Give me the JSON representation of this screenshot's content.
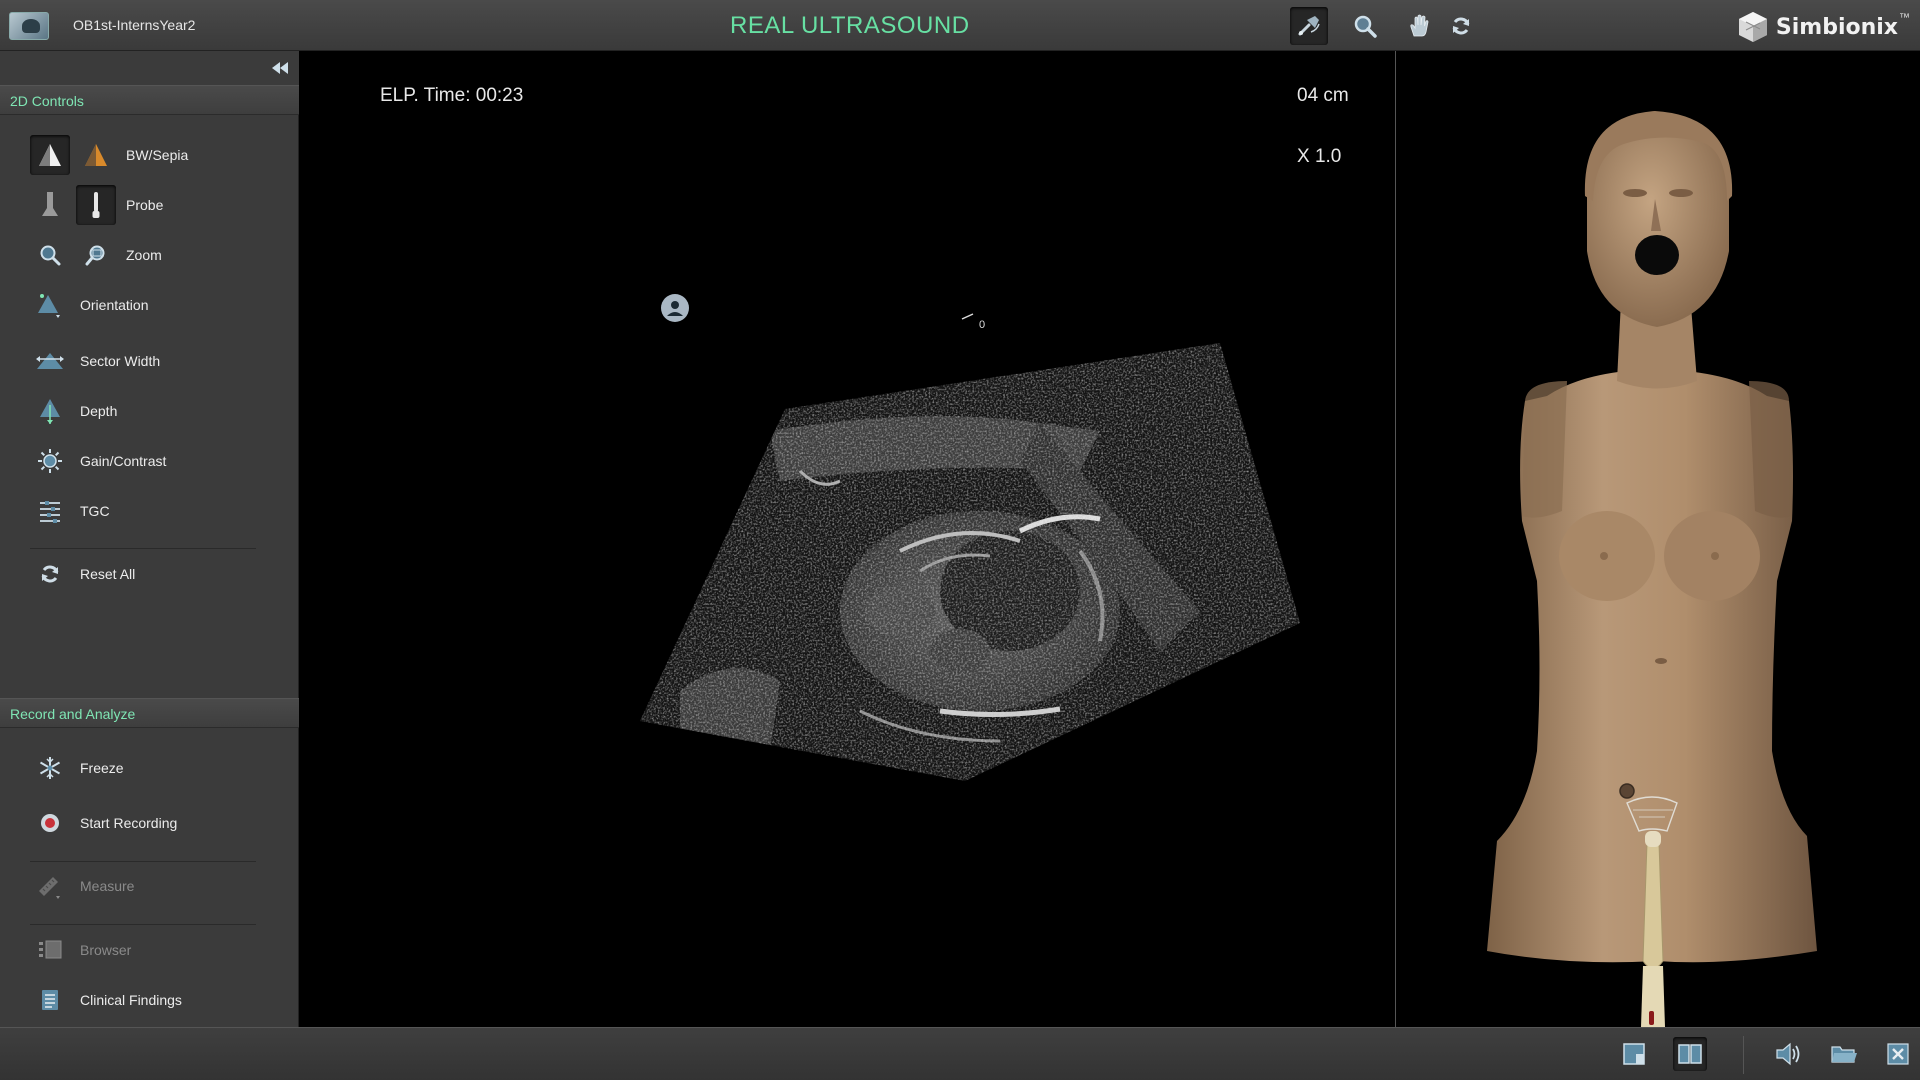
{
  "header": {
    "case_name": "OB1st-InternsYear2",
    "module_title": "REAL ULTRASOUND",
    "brand": "Simbionix",
    "brand_mark": "™",
    "tools": [
      "probe-tool-icon",
      "search-icon",
      "hand-pan-icon",
      "rotate-icon"
    ]
  },
  "left_panel": {
    "controls_header": "2D Controls",
    "controls": [
      {
        "id": "bw-sepia",
        "label": "BW/Sepia"
      },
      {
        "id": "probe",
        "label": "Probe"
      },
      {
        "id": "zoom",
        "label": "Zoom"
      },
      {
        "id": "orientation",
        "label": "Orientation"
      },
      {
        "id": "sector-width",
        "label": "Sector Width"
      },
      {
        "id": "depth",
        "label": "Depth"
      },
      {
        "id": "gain-contrast",
        "label": "Gain/Contrast"
      },
      {
        "id": "tgc",
        "label": "TGC"
      },
      {
        "id": "reset-all",
        "label": "Reset All"
      }
    ],
    "record_header": "Record and Analyze",
    "record_items": [
      {
        "id": "freeze",
        "label": "Freeze",
        "enabled": true
      },
      {
        "id": "start-recording",
        "label": "Start Recording",
        "enabled": true
      },
      {
        "id": "measure",
        "label": "Measure",
        "enabled": false
      },
      {
        "id": "browser",
        "label": "Browser",
        "enabled": false
      },
      {
        "id": "clinical-findings",
        "label": "Clinical Findings",
        "enabled": true
      }
    ]
  },
  "ultrasound": {
    "elapsed_time": "ELP. Time: 00:23",
    "depth": "04 cm",
    "zoom": "X 1.0",
    "scale_zero": "0"
  },
  "bottom_bar": {
    "buttons": [
      "single-view-icon",
      "split-view-icon",
      "volume-icon",
      "folder-icon",
      "close-icon"
    ]
  },
  "colors": {
    "accent_green": "#67e0a3",
    "section_header_text": "#7fe6b4",
    "panel_bg": "#3b3b3b",
    "skin": "#b08e6c"
  }
}
